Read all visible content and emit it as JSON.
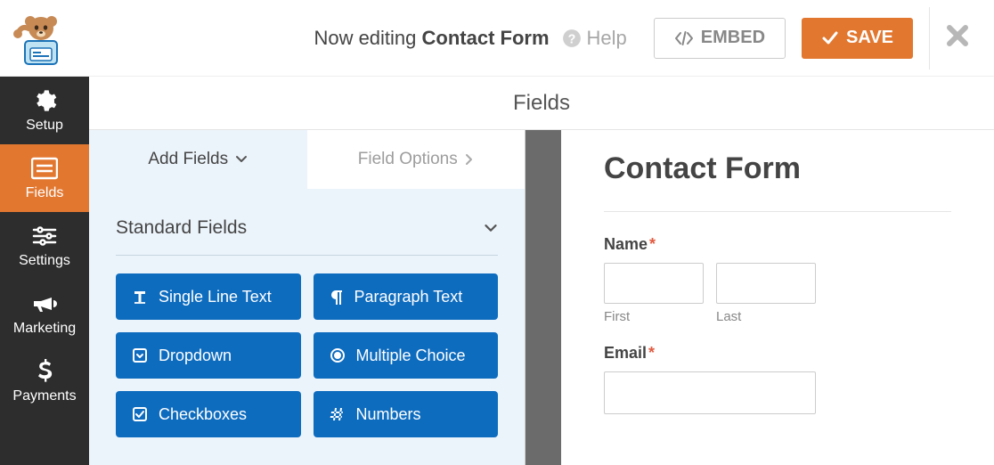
{
  "topbar": {
    "editing_prefix": "Now editing ",
    "form_name": "Contact Form",
    "help_label": "Help",
    "embed_label": "EMBED",
    "save_label": "SAVE"
  },
  "sidebar": {
    "items": [
      {
        "id": "setup",
        "label": "Setup"
      },
      {
        "id": "fields",
        "label": "Fields"
      },
      {
        "id": "settings",
        "label": "Settings"
      },
      {
        "id": "marketing",
        "label": "Marketing"
      },
      {
        "id": "payments",
        "label": "Payments"
      }
    ]
  },
  "content": {
    "header": "Fields",
    "tabs": {
      "add_fields": "Add Fields",
      "field_options": "Field Options"
    },
    "section_title": "Standard Fields",
    "field_buttons": [
      {
        "id": "single-line-text",
        "label": "Single Line Text"
      },
      {
        "id": "paragraph-text",
        "label": "Paragraph Text"
      },
      {
        "id": "dropdown",
        "label": "Dropdown"
      },
      {
        "id": "multiple-choice",
        "label": "Multiple Choice"
      },
      {
        "id": "checkboxes",
        "label": "Checkboxes"
      },
      {
        "id": "numbers",
        "label": "Numbers"
      }
    ]
  },
  "preview": {
    "title": "Contact Form",
    "name_label": "Name",
    "first_label": "First",
    "last_label": "Last",
    "email_label": "Email",
    "required_mark": "*"
  }
}
